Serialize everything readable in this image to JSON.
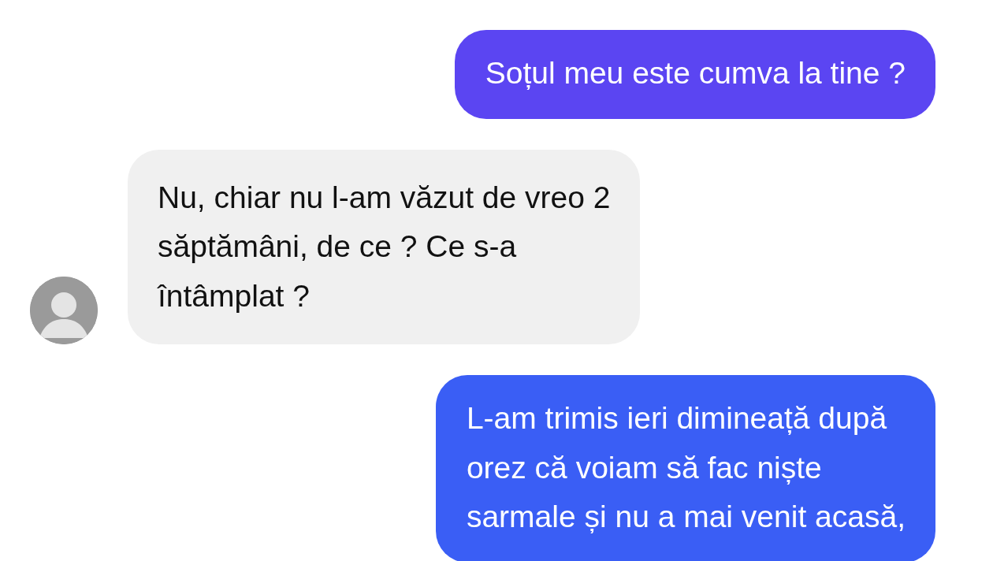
{
  "messages": [
    {
      "kind": "outgoing",
      "color": "#5b45f2",
      "text": "Soțul meu este cumva la tine ?"
    },
    {
      "kind": "incoming",
      "color": "#f0f0f0",
      "text": "Nu, chiar nu l-am văzut de vreo 2\nsăptămâni, de ce ? Ce s-a\nîntâmplat ?"
    },
    {
      "kind": "outgoing",
      "color": "#3a5ef5",
      "text": "L-am trimis ieri dimineață după\norez că voiam să fac niște\nsarmale și nu a mai venit acasă,"
    }
  ]
}
